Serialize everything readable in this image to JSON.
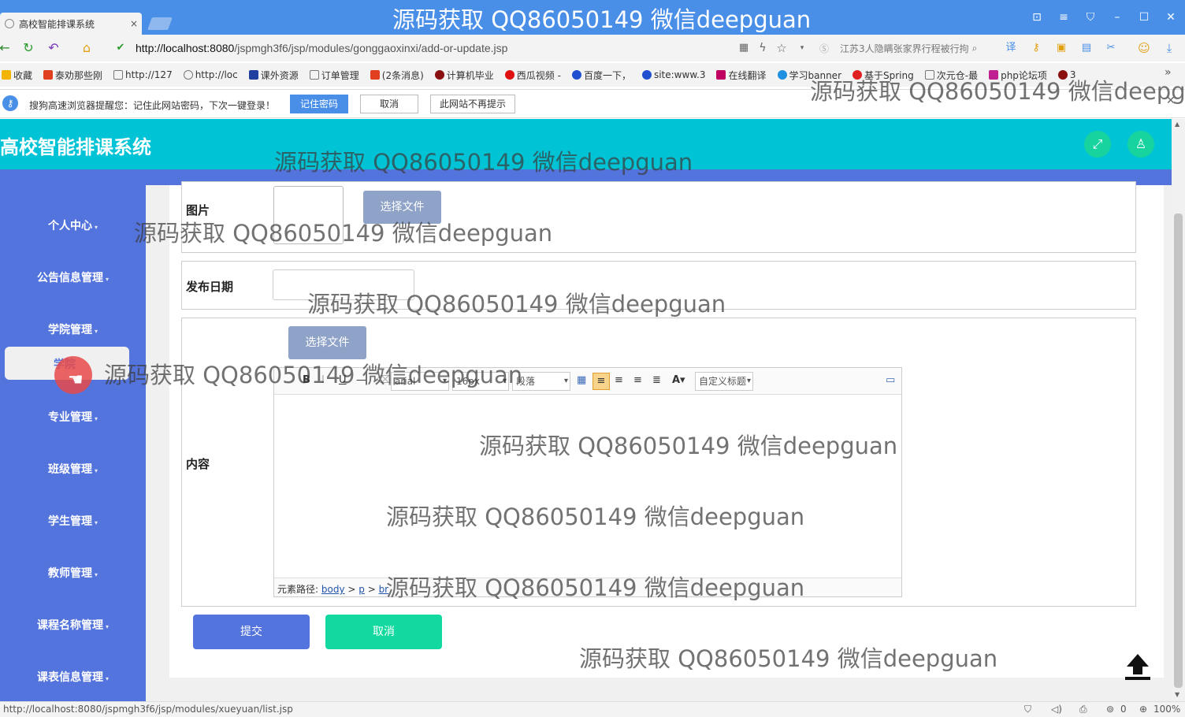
{
  "browser": {
    "tab_title": "高校智能排课系统",
    "tab_close": "×",
    "url_host": "http://localhost:8080",
    "url_path": "/jspmgh3f6/jsp/modules/gonggaoxinxi/add-or-update.jsp",
    "search_placeholder": "江苏3人隐瞒张家界行程被行拘",
    "bookmarks": [
      "收藏",
      "泰劝那些刚",
      "http://127",
      "http://loc",
      "课外资源",
      "订单管理",
      "(2条消息)",
      "计算机毕业",
      "西瓜视频 -",
      "百度一下，",
      "site:www.3",
      "在线翻译",
      "学习banner",
      "基于Spring",
      "次元仓-最",
      "php论坛项",
      "3"
    ],
    "status_url": "http://localhost:8080/jspmgh3f6/jsp/modules/xueyuan/list.jsp",
    "zoom": "100%",
    "download_count": "0"
  },
  "password_bar": {
    "message": "搜狗高速浏览器提醒您：记住此网站密码，下次一键登录！",
    "remember": "记住密码",
    "cancel": "取消",
    "never": "此网站不再提示"
  },
  "app": {
    "title": "高校智能排课系统"
  },
  "sidebar": {
    "items": [
      "个人中心",
      "公告信息管理",
      "学院管理",
      "专业管理",
      "班级管理",
      "学生管理",
      "教师管理",
      "课程名称管理",
      "课表信息管理"
    ],
    "active_sub": "学院"
  },
  "form": {
    "image_label": "图片",
    "choose_file": "选择文件",
    "date_label": "发布日期",
    "content_label": "内容",
    "content_choose_file": "选择文件",
    "editor": {
      "font": "arial",
      "size": "16px",
      "paragraph": "段落",
      "custom_title": "自定义标题",
      "path_prefix": "元素路径:",
      "path": [
        "body",
        "p",
        "br"
      ]
    },
    "submit": "提交",
    "cancel": "取消"
  },
  "watermark": "源码获取 QQ86050149 微信deepguan",
  "colors": {
    "header": "#00c4d6",
    "sidebar": "#5474dd",
    "submit": "#5474dd",
    "cancel": "#11d9a0"
  }
}
